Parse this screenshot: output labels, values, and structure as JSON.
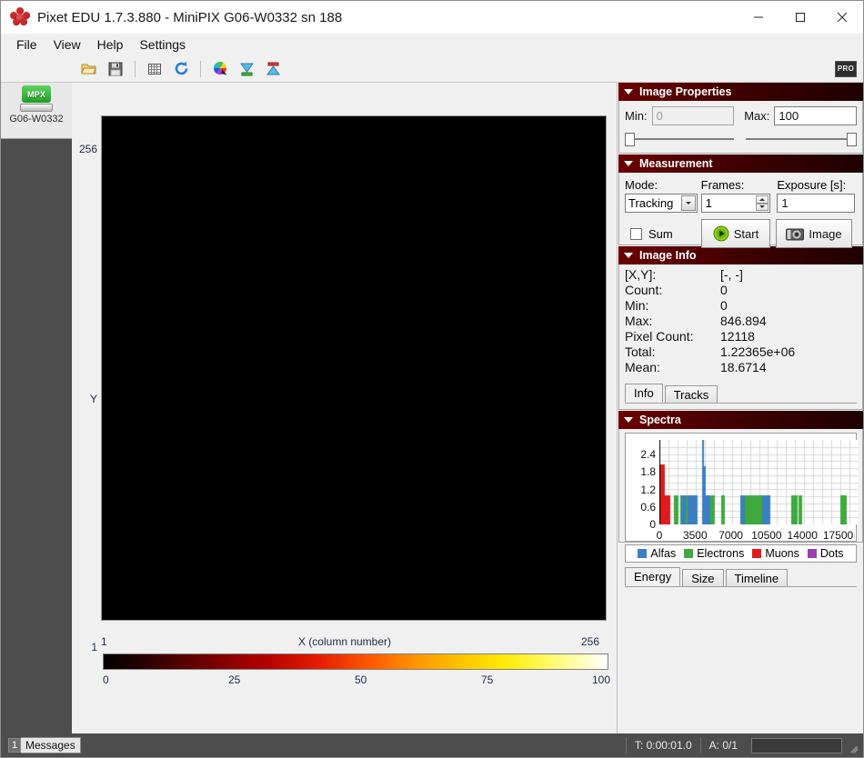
{
  "window": {
    "title": "Pixet EDU 1.7.3.880 - MiniPIX G06-W0332 sn 188",
    "minimize": "—",
    "maximize": "□",
    "close": "✕"
  },
  "menu": {
    "items": [
      "File",
      "View",
      "Help",
      "Settings"
    ]
  },
  "toolbar": {
    "icons": [
      "open-folder-icon",
      "save-floppy-icon",
      "grid-icon",
      "refresh-icon",
      "color-wheel-icon",
      "load-down-icon",
      "load-up-icon"
    ],
    "pro_badge": "PRO"
  },
  "sidebar": {
    "device_label": "G06-W0332",
    "device_icon_text": "MPX"
  },
  "image_view": {
    "y_axis": {
      "top": "256",
      "bottom": "1",
      "label": "Y"
    },
    "x_axis": {
      "left": "1",
      "right": "256",
      "label": "X (column number)"
    },
    "colorbar_ticks": [
      "0",
      "25",
      "50",
      "75",
      "100"
    ]
  },
  "image_properties": {
    "title": "Image Properties",
    "min_label": "Min:",
    "min_value": "0",
    "max_label": "Max:",
    "max_value": "100"
  },
  "measurement": {
    "title": "Measurement",
    "mode_label": "Mode:",
    "mode_value": "Tracking",
    "frames_label": "Frames:",
    "frames_value": "1",
    "exposure_label": "Exposure [s]:",
    "exposure_value": "1",
    "sum_label": "Sum",
    "start_label": "Start",
    "image_label": "Image"
  },
  "image_info": {
    "title": "Image Info",
    "rows": [
      {
        "label": "[X,Y]:",
        "value": "[-, -]"
      },
      {
        "label": "Count:",
        "value": "0"
      },
      {
        "label": "Min:",
        "value": "0"
      },
      {
        "label": "Max:",
        "value": "846.894"
      },
      {
        "label": "Pixel Count:",
        "value": "12118"
      },
      {
        "label": "Total:",
        "value": "1.22365e+06"
      },
      {
        "label": "Mean:",
        "value": "18.6714"
      }
    ],
    "tabs": [
      {
        "label": "Info",
        "active": true
      },
      {
        "label": "Tracks",
        "active": false
      }
    ]
  },
  "spectra": {
    "title": "Spectra",
    "tabs": [
      {
        "label": "Energy",
        "active": true
      },
      {
        "label": "Size",
        "active": false
      },
      {
        "label": "Timeline",
        "active": false
      }
    ],
    "legend": [
      {
        "label": "Alfas",
        "color": "#3a7fc1"
      },
      {
        "label": "Electrons",
        "color": "#3fa93f"
      },
      {
        "label": "Muons",
        "color": "#e01b1b"
      },
      {
        "label": "Dots",
        "color": "#9c3fae"
      }
    ]
  },
  "chart_data": {
    "type": "bar",
    "title": "Spectra",
    "xlabel": "",
    "ylabel": "",
    "xlim": [
      0,
      19500
    ],
    "ylim": [
      0,
      2.9
    ],
    "grid": true,
    "legend_position": "bottom",
    "yticks": [
      0,
      0.6,
      1.2,
      1.8,
      2.4
    ],
    "ytick_labels": [
      "0",
      "0.6",
      "1.2",
      "1.8",
      "2.4"
    ],
    "xticks": [
      0,
      3500,
      7000,
      10500,
      14000,
      17500
    ],
    "xtick_labels": [
      "0",
      "3500",
      "7000",
      "10500",
      "14000",
      "17500"
    ],
    "series": [
      {
        "name": "Muons",
        "color": "#e01b1b",
        "points": [
          [
            120,
            2.05
          ],
          [
            200,
            2.05
          ],
          [
            280,
            1.0
          ],
          [
            360,
            1.0
          ],
          [
            440,
            1.0
          ],
          [
            520,
            1.0
          ],
          [
            600,
            1.0
          ],
          [
            680,
            1.0
          ]
        ]
      },
      {
        "name": "Electrons",
        "color": "#3fa93f",
        "points": [
          [
            1400,
            1.0
          ],
          [
            1500,
            1.0
          ],
          [
            2050,
            1.0
          ],
          [
            2400,
            1.0
          ],
          [
            2600,
            1.0
          ],
          [
            2950,
            1.0
          ],
          [
            3150,
            1.0
          ],
          [
            4750,
            1.0
          ],
          [
            5050,
            1.0
          ],
          [
            6050,
            1.0
          ],
          [
            8150,
            1.0
          ],
          [
            8450,
            1.0
          ],
          [
            8700,
            1.0
          ],
          [
            8900,
            1.0
          ],
          [
            9100,
            1.0
          ],
          [
            9300,
            1.0
          ],
          [
            9500,
            1.0
          ],
          [
            9750,
            1.0
          ],
          [
            9950,
            1.0
          ],
          [
            10200,
            1.0
          ],
          [
            12900,
            1.0
          ],
          [
            13150,
            1.0
          ],
          [
            13600,
            1.0
          ],
          [
            17750,
            1.0
          ],
          [
            17950,
            1.0
          ]
        ]
      },
      {
        "name": "Alfas",
        "color": "#3a7fc1",
        "points": [
          [
            2150,
            1.0
          ],
          [
            2250,
            1.0
          ],
          [
            2750,
            1.0
          ],
          [
            3050,
            1.0
          ],
          [
            3350,
            1.0
          ],
          [
            4150,
            2.9
          ],
          [
            4200,
            2.0
          ],
          [
            4250,
            1.0
          ],
          [
            4400,
            1.0
          ],
          [
            4500,
            1.0
          ],
          [
            4600,
            1.0
          ],
          [
            7950,
            1.0
          ],
          [
            8050,
            1.0
          ],
          [
            10050,
            1.0
          ],
          [
            10350,
            1.0
          ],
          [
            10550,
            1.0
          ]
        ]
      },
      {
        "name": "Dots",
        "color": "#9c3fae",
        "points": []
      }
    ]
  },
  "status": {
    "message_count": "1",
    "messages_label": "Messages",
    "time": "T: 0:00:01.0",
    "acquisition": "A: 0/1"
  }
}
